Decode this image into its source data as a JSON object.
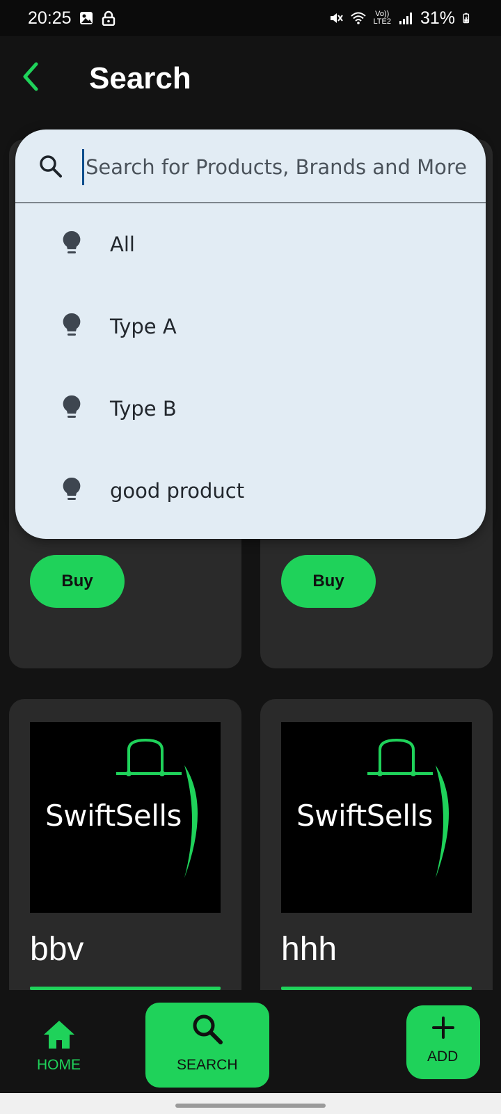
{
  "status_bar": {
    "time": "20:25",
    "battery": "31%",
    "network_label": "LTE2",
    "volte_label": "Vo))"
  },
  "header": {
    "title": "Search",
    "back_icon": "chevron-left-icon"
  },
  "search": {
    "placeholder": "Search for Products, Brands and More",
    "value": ""
  },
  "suggestions": [
    {
      "label": "All",
      "icon": "lightbulb-icon"
    },
    {
      "label": "Type A",
      "icon": "lightbulb-icon"
    },
    {
      "label": "Type B",
      "icon": "lightbulb-icon"
    },
    {
      "label": "good product",
      "icon": "lightbulb-icon"
    }
  ],
  "products_top": [
    {
      "buy_label": "Buy"
    },
    {
      "buy_label": "Buy"
    }
  ],
  "products_bottom": [
    {
      "name": "bbv",
      "logo_text": "SwiftSells"
    },
    {
      "name": "hhh",
      "logo_text": "SwiftSells"
    }
  ],
  "bottom_nav": {
    "home_label": "HOME",
    "search_label": "SEARCH",
    "add_label": "ADD"
  },
  "colors": {
    "accent": "#1fd25a",
    "background": "#131313",
    "card": "#2a2a2a",
    "panel": "#e2ecf4"
  }
}
